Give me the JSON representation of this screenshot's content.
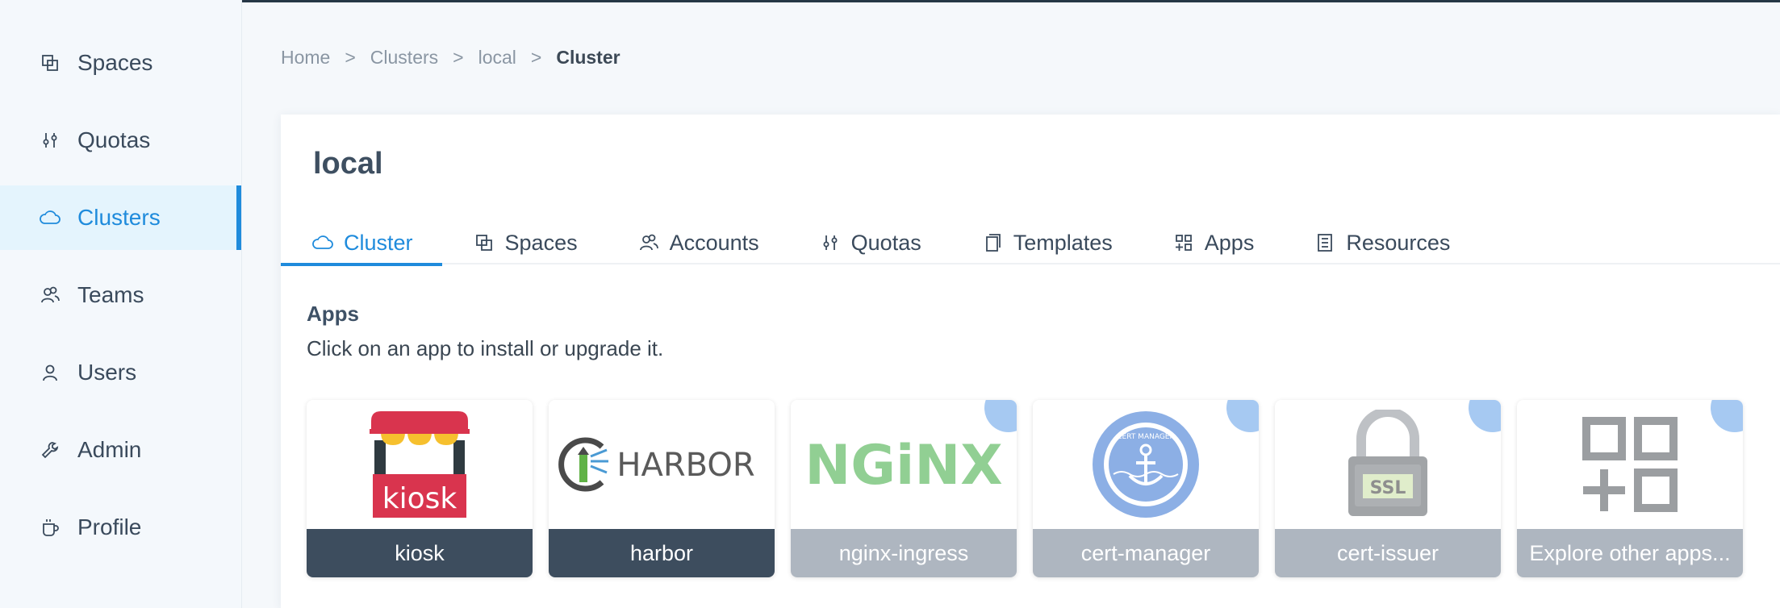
{
  "sidebar": {
    "items": [
      {
        "label": "Spaces",
        "icon": "spaces-icon"
      },
      {
        "label": "Quotas",
        "icon": "sliders-icon"
      },
      {
        "label": "Clusters",
        "icon": "cloud-icon",
        "active": true
      },
      {
        "label": "Teams",
        "icon": "team-icon"
      },
      {
        "label": "Users",
        "icon": "user-icon"
      },
      {
        "label": "Admin",
        "icon": "wrench-icon"
      },
      {
        "label": "Profile",
        "icon": "mug-icon"
      }
    ]
  },
  "breadcrumb": {
    "home": "Home",
    "clusters": "Clusters",
    "local": "local",
    "current": "Cluster",
    "sep": ">"
  },
  "card": {
    "title": "local",
    "tabs": [
      {
        "label": "Cluster",
        "icon": "cloud-icon"
      },
      {
        "label": "Spaces",
        "icon": "spaces-icon"
      },
      {
        "label": "Accounts",
        "icon": "accounts-icon"
      },
      {
        "label": "Quotas",
        "icon": "sliders-icon"
      },
      {
        "label": "Templates",
        "icon": "templates-icon"
      },
      {
        "label": "Apps",
        "icon": "apps-icon"
      },
      {
        "label": "Resources",
        "icon": "resources-icon"
      }
    ],
    "section_title": "Apps",
    "section_desc": "Click on an app to install or upgrade it.",
    "apps": [
      {
        "name": "kiosk",
        "logo_text": "kiosk",
        "status": "installed"
      },
      {
        "name": "harbor",
        "logo_text": "HARBOR",
        "status": "installed"
      },
      {
        "name": "nginx-ingress",
        "logo_text": "NGiNX",
        "status": "available"
      },
      {
        "name": "cert-manager",
        "logo_text": "CERT MANAGER",
        "status": "available"
      },
      {
        "name": "cert-issuer",
        "logo_text": "SSL",
        "status": "available"
      },
      {
        "name": "Explore other apps...",
        "status": "available"
      }
    ]
  },
  "colors": {
    "accent": "#1f8bdc",
    "installed_label": "#3d4d5e",
    "available_label": "#aeb6c0",
    "corner_badge": "#a6c9f2"
  }
}
